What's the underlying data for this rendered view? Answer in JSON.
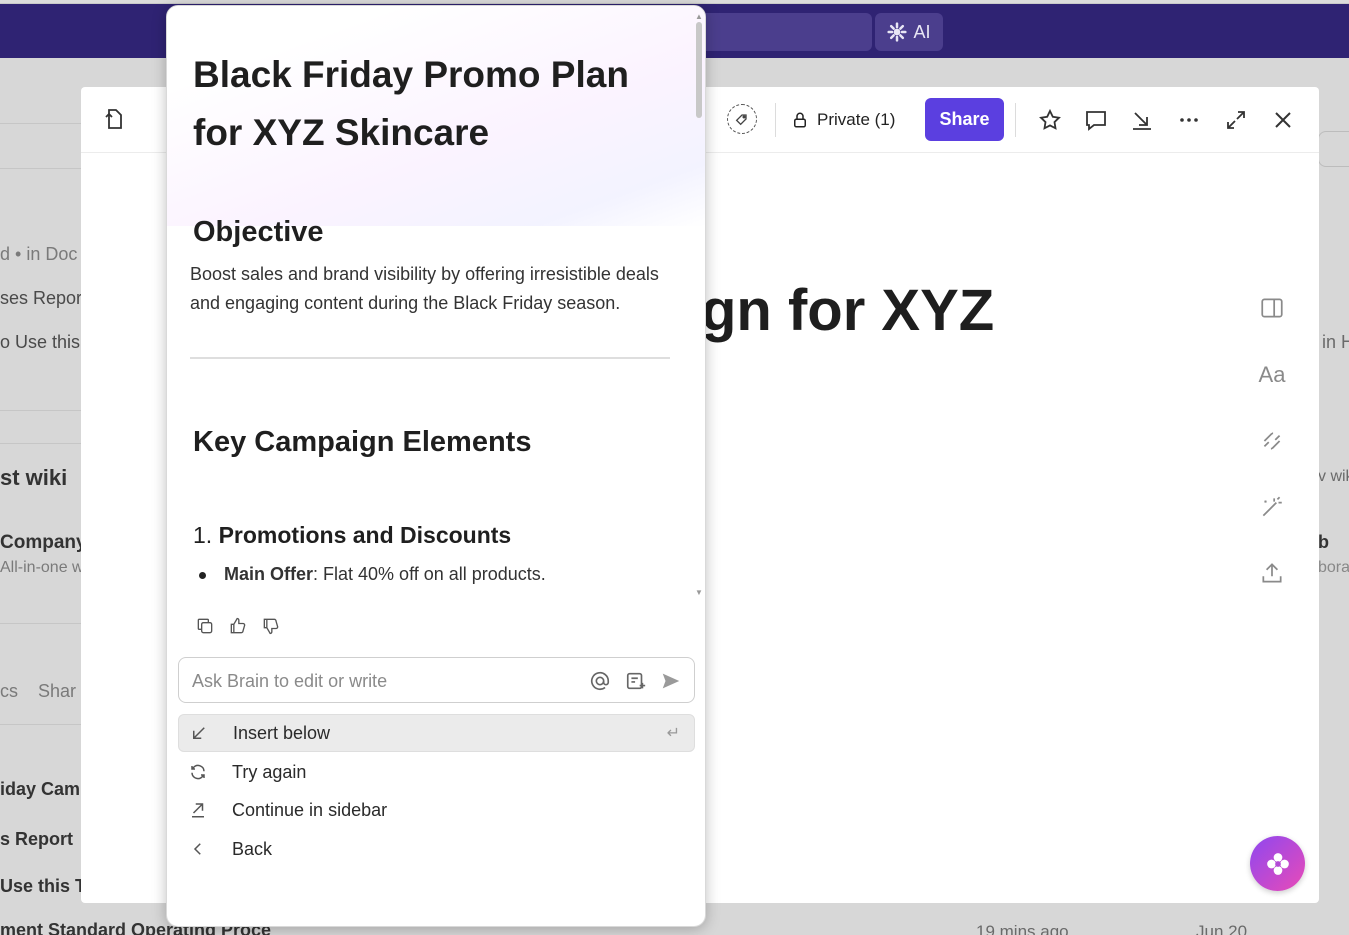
{
  "topbar": {
    "ai_label": "AI"
  },
  "background": {
    "rows": [
      "d",
      "• in Doc",
      "ses Report",
      "o Use this",
      "st wiki",
      "Company",
      "All-in-one w",
      "cs",
      "Shar",
      "iday Camp",
      "s Report",
      "Use this T",
      "ment Standard Operating Proce"
    ],
    "right": [
      "in H",
      "v wik",
      "b",
      "bora"
    ],
    "times": [
      "19 mins ago",
      "Jun 20"
    ]
  },
  "modal": {
    "header": {
      "private_label": "Private (1)",
      "share_label": "Share"
    },
    "doc_title_fragment": "gn for XYZ",
    "side_tools": {
      "aa_label": "Aa"
    }
  },
  "popup": {
    "title": "Black Friday Promo Plan for XYZ Skincare",
    "objective_heading": "Objective",
    "objective_text": "Boost sales and brand visibility by offering irresistible deals and engaging content during the Black Friday season.",
    "key_heading": "Key Campaign Elements",
    "section1_number": "1.",
    "section1_title": "Promotions and Discounts",
    "bullet1_label": "Main Offer",
    "bullet1_text": ": Flat 40% off on all products.",
    "ask_placeholder": "Ask Brain to edit or write",
    "menu": {
      "insert_below": "Insert below",
      "try_again": "Try again",
      "continue_sidebar": "Continue in sidebar",
      "back": "Back"
    }
  },
  "colors": {
    "topbar": "#2f2373",
    "share": "#5b3fe0",
    "fab_from": "#8e48f0",
    "fab_to": "#e94ab7"
  }
}
